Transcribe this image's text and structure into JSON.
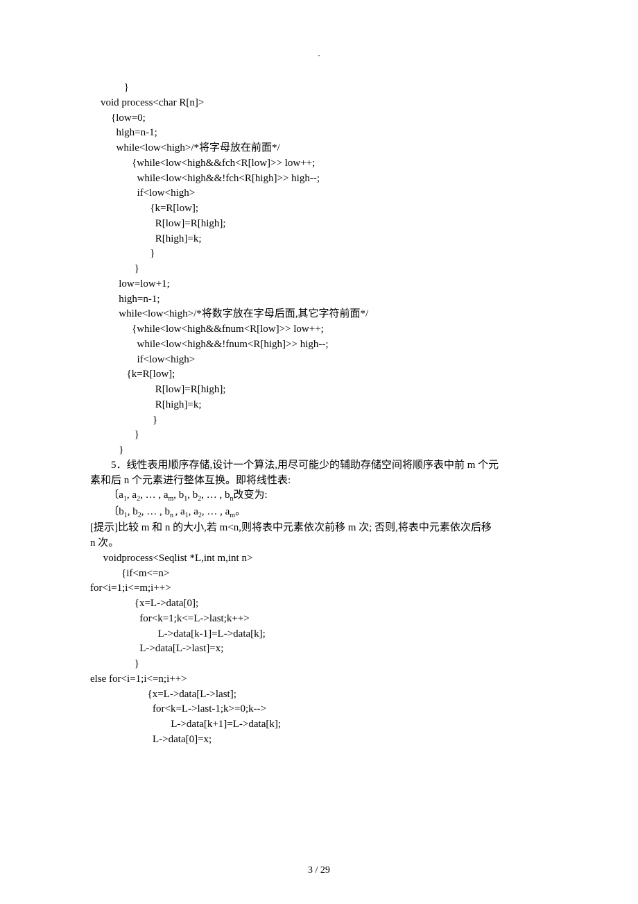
{
  "header_dot": ".",
  "code_top": "             }\n    void process<char R[n]>\n        {low=0;\n          high=n-1;\n          while<low<high>/*将字母放在前面*/\n                {while<low<high&&fch<R[low]>> low++;\n                  while<low<high&&!fch<R[high]>> high--;\n                  if<low<high>\n                       {k=R[low];\n                         R[low]=R[high];\n                         R[high]=k;\n                       }\n                 }\n           low=low+1;\n           high=n-1;\n           while<low<high>/*将数字放在字母后面,其它字符前面*/\n                {while<low<high&&fnum<R[low]>> low++;\n                  while<low<high&&!fnum<R[high]>> high--;\n                  if<low<high>\n              {k=R[low];\n                         R[low]=R[high];\n                         R[high]=k;\n                        }\n                 }\n           }",
  "problem5": {
    "title_line1": "5．线性表用顺序存储,设计一个算法,用尽可能少的辅助存储空间将顺序表中前 m 个元",
    "title_line2": "素和后 n 个元素进行整体互换。即将线性表:",
    "formula1_prefix": "        〔a",
    "formula1_rest": ", a",
    "formula1_end": "改变为:",
    "formula2_prefix": "        〔b",
    "formula2_rest": ", b",
    "hint_line1": "[提示]比较 m 和 n 的大小,若 m<n,则将表中元素依次前移 m 次;  否则,将表中元素依次后移",
    "hint_line2": "n 次。"
  },
  "code_bottom": "     voidprocess<Seqlist *L,int m,int n>\n            {if<m<=n>\nfor<i=1;i<=m;i++>\n                 {x=L->data[0];\n                   for<k=1;k<=L->last;k++>\n                          L->data[k-1]=L->data[k];\n                   L->data[L->last]=x;\n                 }\nelse for<i=1;i<=n;i++>\n                      {x=L->data[L->last];\n                        for<k=L->last-1;k>=0;k-->\n                               L->data[k+1]=L->data[k];\n                        L->data[0]=x;",
  "footer": "3  / 29"
}
